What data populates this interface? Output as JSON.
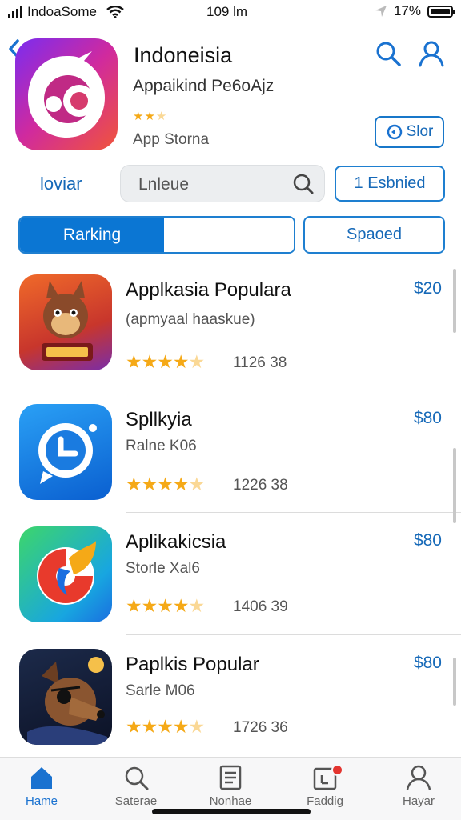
{
  "status_bar": {
    "carrier": "IndoaSome",
    "time": "109 lm",
    "battery": "17%"
  },
  "header": {
    "title": "Indoneisia",
    "subtitle": "Appaikind Pe6oAjz",
    "store": "App  Storna",
    "store_button": "Slor"
  },
  "filters": {
    "link": "loviar",
    "search_placeholder": "Lnleue",
    "button": "1 Esbnied"
  },
  "segments": {
    "active": "Rarking",
    "other": "Spaoed"
  },
  "apps": [
    {
      "name": "Applkasia Popularа",
      "subtitle": "(apmyaal haaskue)",
      "rating": "1126  38",
      "price": "$20",
      "stars": 4.5
    },
    {
      "name": "Spllkyia",
      "subtitle": "Ralne K06",
      "rating": "1226  38",
      "price": "$80",
      "stars": 4.5
    },
    {
      "name": "Aplikakicsia",
      "subtitle": "Storle Xal6",
      "rating": "1406  39",
      "price": "$80",
      "stars": 4.5
    },
    {
      "name": "Paplkis Popular",
      "subtitle": "Sarle M06",
      "rating": "1726  36",
      "price": "$80",
      "stars": 4.5
    }
  ],
  "tabs": [
    {
      "label": "Hame"
    },
    {
      "label": "Saterae"
    },
    {
      "label": "Nonhae"
    },
    {
      "label": "Faddig"
    },
    {
      "label": "Hayar"
    }
  ],
  "colors": {
    "accent": "#0b76d3",
    "star": "#f5a917"
  }
}
